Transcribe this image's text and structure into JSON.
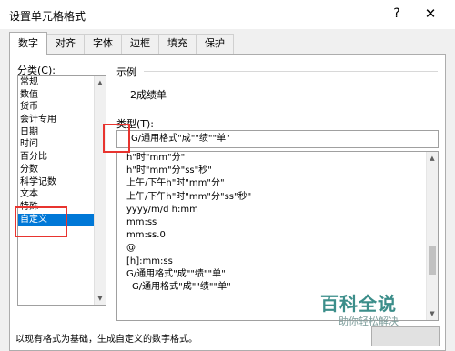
{
  "window": {
    "title": "设置单元格格式",
    "help": "?",
    "close": "✕"
  },
  "tabs": [
    {
      "label": "数字",
      "active": true
    },
    {
      "label": "对齐",
      "active": false
    },
    {
      "label": "字体",
      "active": false
    },
    {
      "label": "边框",
      "active": false
    },
    {
      "label": "填充",
      "active": false
    },
    {
      "label": "保护",
      "active": false
    }
  ],
  "category": {
    "label": "分类(C):",
    "items": [
      "常规",
      "数值",
      "货币",
      "会计专用",
      "日期",
      "时间",
      "百分比",
      "分数",
      "科学记数",
      "文本",
      "特殊",
      "自定义"
    ],
    "selected": "自定义"
  },
  "sample": {
    "label": "示例",
    "value": "2成绩单"
  },
  "type": {
    "label": "类型(T):",
    "value": "G/通用格式\"成\"\"绩\"\"单\"",
    "list": [
      "h\"时\"mm\"分\"",
      "h\"时\"mm\"分\"ss\"秒\"",
      "上午/下午h\"时\"mm\"分\"",
      "上午/下午h\"时\"mm\"分\"ss\"秒\"",
      "yyyy/m/d h:mm",
      "mm:ss",
      "mm:ss.0",
      "@",
      "[h]:mm:ss",
      "G/通用格式\"成\"\"绩\"\"单\"",
      "G/通用格式\"成\"\"绩\"\"单\""
    ]
  },
  "description": "以现有格式为基础，生成自定义的数字格式。",
  "watermark": {
    "title": "百科全说",
    "subtitle": "助你轻松解决"
  },
  "colors": {
    "selection": "#0078d7",
    "highlight": "#e8342f",
    "watermark": "#3c8e8a"
  }
}
